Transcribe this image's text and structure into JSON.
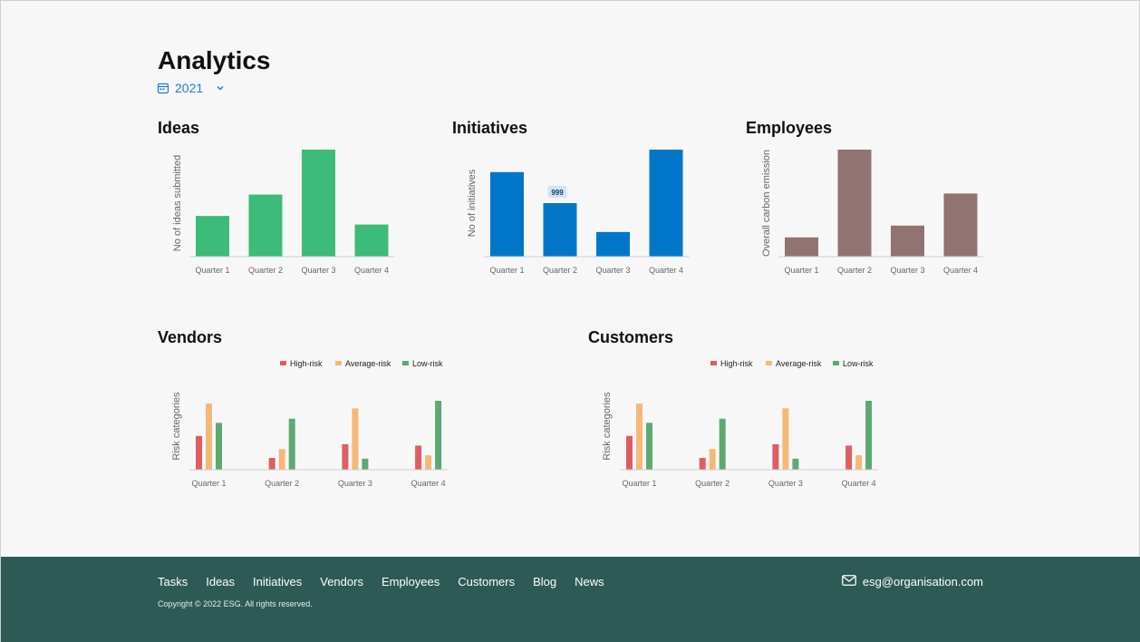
{
  "page": {
    "title": "Analytics",
    "year": "2021"
  },
  "charts": {
    "ideas_title": "Ideas",
    "initiatives_title": "Initiatives",
    "employees_title": "Employees",
    "vendors_title": "Vendors",
    "customers_title": "Customers"
  },
  "colors": {
    "ideas": "#3dbb78",
    "initiatives": "#0277c9",
    "employees": "#917372",
    "high_risk": "#e05c63",
    "average_risk": "#f5b977",
    "low_risk": "#5ea873",
    "footer_bg": "#2d5a54",
    "accent": "#1d7fcf"
  },
  "chart_data": [
    {
      "type": "bar",
      "title": "Ideas",
      "ylabel": "No of ideas submitted",
      "categories": [
        "Quarter 1",
        "Quarter 2",
        "Quarter 3",
        "Quarter 4"
      ],
      "values": [
        38,
        58,
        100,
        30
      ],
      "ylim": [
        0,
        100
      ],
      "grid": false
    },
    {
      "type": "bar",
      "title": "Initiatives",
      "ylabel": "No of initiatives",
      "categories": [
        "Quarter 1",
        "Quarter 2",
        "Quarter 3",
        "Quarter 4"
      ],
      "values": [
        79,
        50,
        23,
        100
      ],
      "ylim": [
        0,
        100
      ],
      "annotations": [
        {
          "category": "Quarter 2",
          "text": "999"
        }
      ],
      "grid": false
    },
    {
      "type": "bar",
      "title": "Employees",
      "ylabel": "Overall carbon emission",
      "categories": [
        "Quarter 1",
        "Quarter 2",
        "Quarter 3",
        "Quarter 4"
      ],
      "values": [
        18,
        100,
        29,
        59
      ],
      "ylim": [
        0,
        100
      ],
      "grid": false
    },
    {
      "type": "bar",
      "title": "Vendors",
      "ylabel": "Risk categories",
      "categories": [
        "Quarter 1",
        "Quarter 2",
        "Quarter 3",
        "Quarter 4"
      ],
      "series": [
        {
          "name": "High-risk",
          "values": [
            49,
            17,
            37,
            35
          ]
        },
        {
          "name": "Average-risk",
          "values": [
            96,
            30,
            89,
            21
          ]
        },
        {
          "name": "Low-risk",
          "values": [
            68,
            74,
            16,
            100
          ]
        }
      ],
      "ylim": [
        0,
        100
      ],
      "legend": "top-right",
      "grid": false
    },
    {
      "type": "bar",
      "title": "Customers",
      "ylabel": "Risk categories",
      "categories": [
        "Quarter 1",
        "Quarter 2",
        "Quarter 3",
        "Quarter 4"
      ],
      "series": [
        {
          "name": "High-risk",
          "values": [
            49,
            17,
            37,
            35
          ]
        },
        {
          "name": "Average-risk",
          "values": [
            96,
            30,
            89,
            21
          ]
        },
        {
          "name": "Low-risk",
          "values": [
            68,
            74,
            16,
            100
          ]
        }
      ],
      "ylim": [
        0,
        100
      ],
      "legend": "top-right",
      "grid": false
    }
  ],
  "footer": {
    "nav": [
      "Tasks",
      "Ideas",
      "Initiatives",
      "Vendors",
      "Employees",
      "Customers",
      "Blog",
      "News"
    ],
    "email": "esg@organisation.com",
    "copyright": "Copyright © 2022 ESG. All rights reserved."
  }
}
